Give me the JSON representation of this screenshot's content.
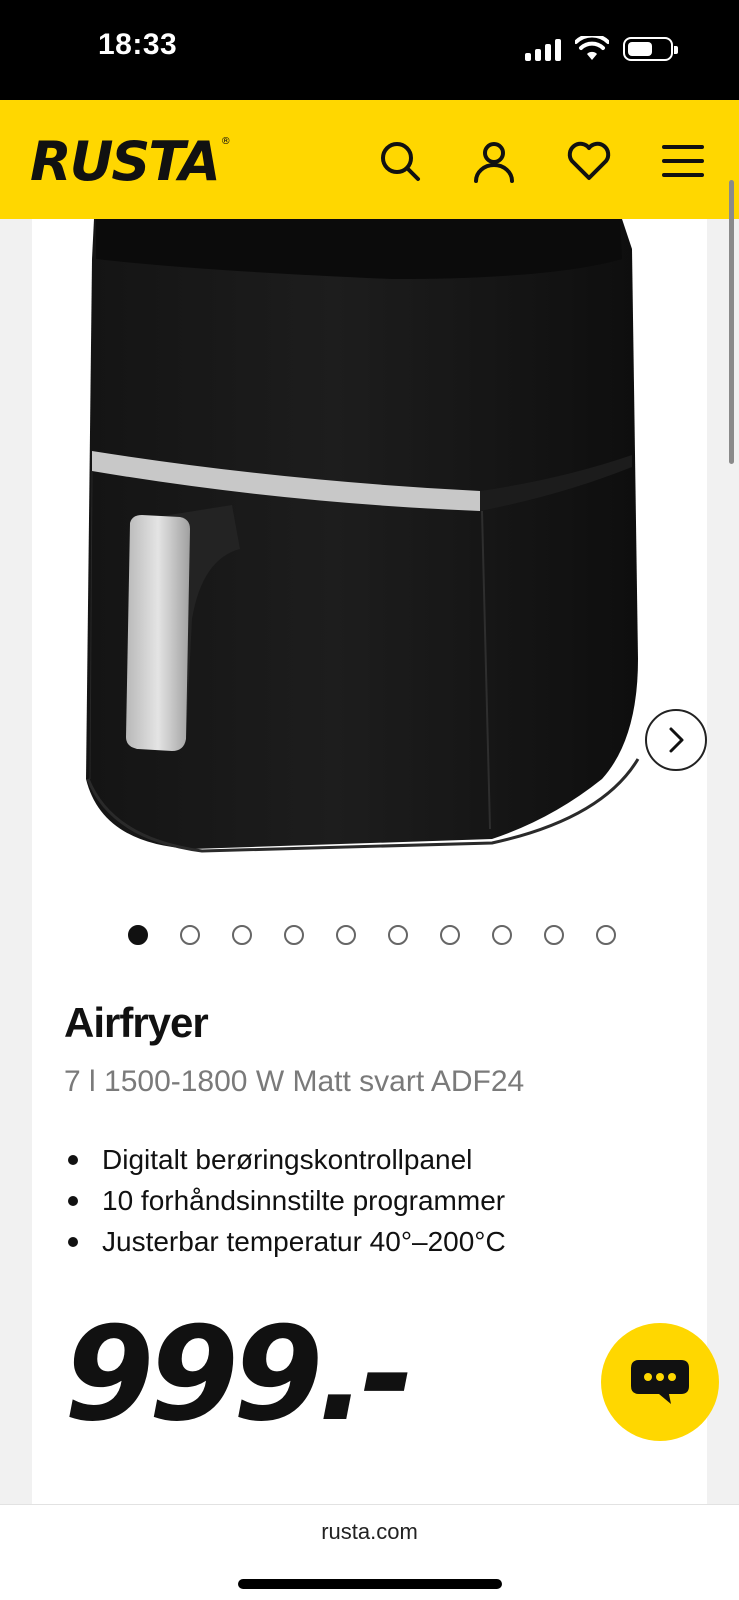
{
  "status": {
    "time": "18:33"
  },
  "header": {
    "logo": "RUSTA",
    "logo_mark": "®",
    "icons": [
      "search-icon",
      "account-icon",
      "heart-icon",
      "menu-icon"
    ]
  },
  "gallery": {
    "image_count": 10,
    "active_index": 0
  },
  "product": {
    "title": "Airfryer",
    "subtitle": "7 l 1500-1800 W Matt svart ADF24",
    "features": [
      "Digitalt berøringskontrollpanel",
      "10 forhåndsinnstilte programmer",
      "Justerbar temperatur 40°–200°C"
    ],
    "price": "999.-"
  },
  "browser": {
    "url": "rusta.com"
  },
  "colors": {
    "brand_yellow": "#ffd700",
    "text": "#111111",
    "muted": "#7a7a7a"
  }
}
